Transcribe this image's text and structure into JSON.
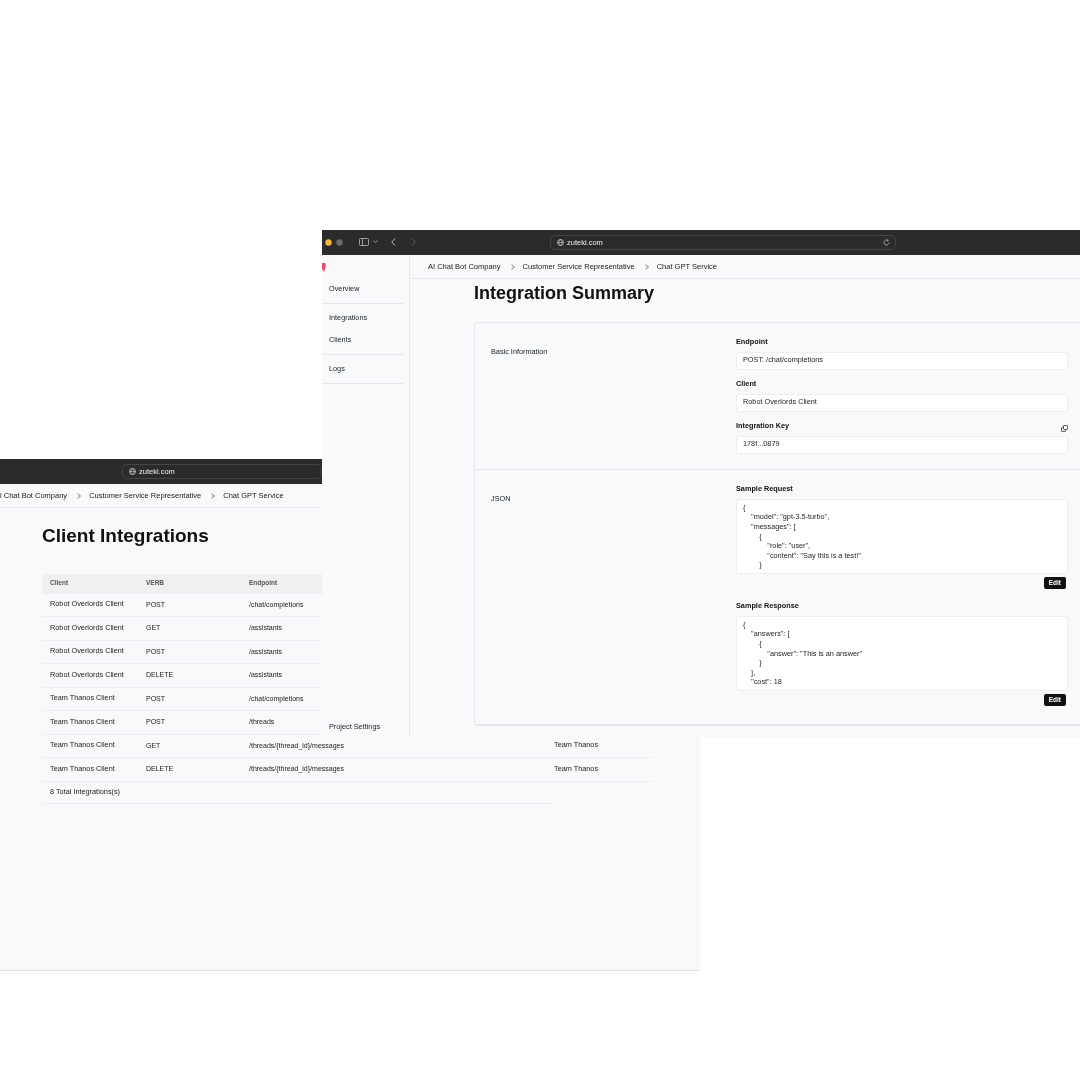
{
  "back_window": {
    "address": "zuteki.com",
    "breadcrumb": [
      "l Chat Bot Company",
      "Customer Service Representative",
      "Chat GPT Service"
    ],
    "title": "Client Integrations",
    "table": {
      "columns": [
        "Client",
        "VERB",
        "Endpoint"
      ],
      "rows": [
        {
          "client": "Robot Overlords Client",
          "verb": "POST",
          "endpoint": "/chat/completions"
        },
        {
          "client": "Robot Overlords Client",
          "verb": "GET",
          "endpoint": "/assistants"
        },
        {
          "client": "Robot Overlords Client",
          "verb": "POST",
          "endpoint": "/assistants"
        },
        {
          "client": "Robot Overlords Client",
          "verb": "DELETE",
          "endpoint": "/assistants"
        },
        {
          "client": "Team Thanos Client",
          "verb": "POST",
          "endpoint": "/chat/completions"
        },
        {
          "client": "Team Thanos Client",
          "verb": "POST",
          "endpoint": "/threads"
        },
        {
          "client": "Team Thanos Client",
          "verb": "GET",
          "endpoint": "/threads/{thread_id}/messages",
          "column_4": "Team Thanos"
        },
        {
          "client": "Team Thanos Client",
          "verb": "DELETE",
          "endpoint": "/threads/{thread_id}/messages",
          "column_4": "Team Thanos"
        }
      ],
      "footer": "8 Total Integrations(s)"
    }
  },
  "front_window": {
    "address": "zuteki.com",
    "breadcrumb": [
      "AI Chat Bot Company",
      "Customer Service Representative",
      "Chat GPT Service"
    ],
    "sidebar": {
      "items": [
        {
          "label": "Overview"
        },
        {
          "label": "Integrations"
        },
        {
          "label": "Clients"
        },
        {
          "label": "Logs"
        }
      ],
      "footer_item": "Project Settings"
    },
    "title": "Integration Summary",
    "sections": [
      {
        "label": "Basic Information",
        "fields": [
          {
            "kind": "input",
            "label": "Endpoint",
            "value": "POST: /chat/completions",
            "copyable": false
          },
          {
            "kind": "input",
            "label": "Client",
            "value": "Robot Overlords Client",
            "copyable": false
          },
          {
            "kind": "input",
            "label": "Integration Key",
            "value": "178f...0879",
            "copyable": true
          }
        ]
      },
      {
        "label": "JSON",
        "fields": [
          {
            "kind": "code",
            "label": "Sample Request",
            "value": "{\n    \"model\": \"gpt-3.5-turbo\",\n    \"messages\": [\n        {\n            \"role\": \"user\",\n            \"content\": \"Say this is a test!\"\n        }",
            "button": "Edit"
          },
          {
            "kind": "code",
            "label": "Sample Response",
            "value": "{\n    \"answers\": [\n        {\n            \"answer\": \"This is an answer\"\n        }\n    ],\n    \"cost\": 18",
            "button": "Edit"
          }
        ]
      }
    ]
  }
}
